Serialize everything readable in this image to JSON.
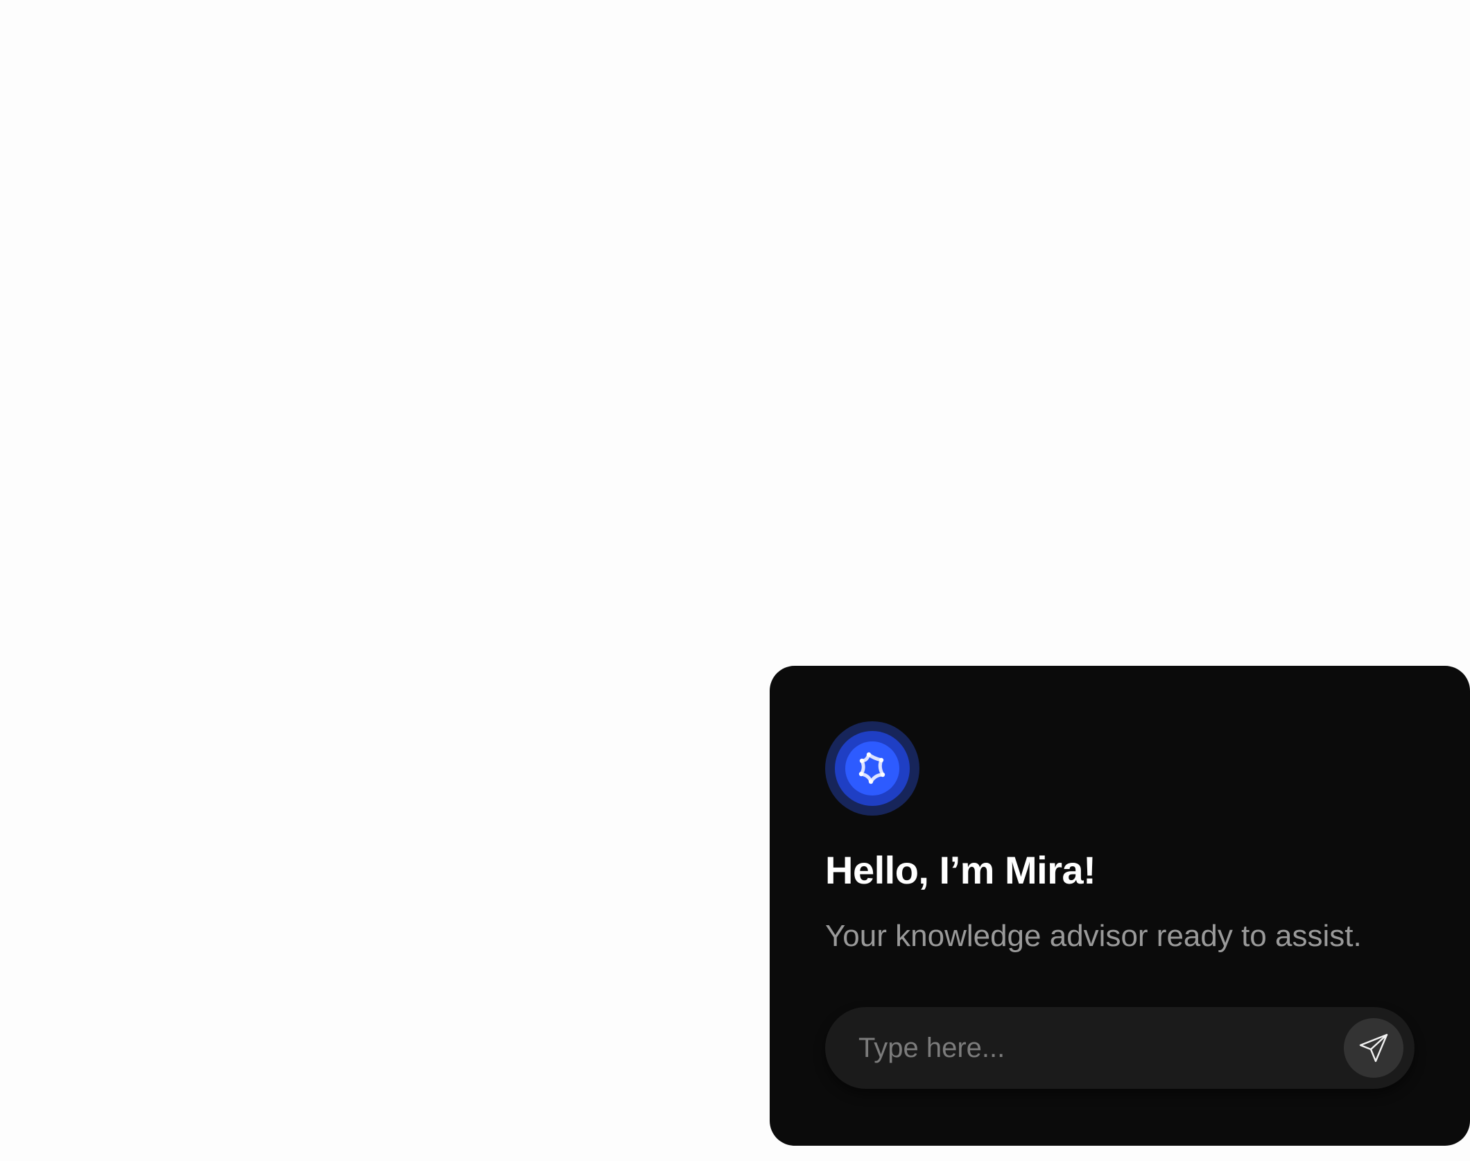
{
  "assistant": {
    "title": "Hello, I’m Mira!",
    "subtitle": "Your knowledge advisor ready to assist.",
    "avatar_icon": "sparkle-star-icon"
  },
  "composer": {
    "placeholder": "Type here...",
    "value": "",
    "send_icon": "paper-plane-icon"
  },
  "colors": {
    "card_background": "#0b0b0b",
    "page_background": "#fdfdfd",
    "avatar_outer": "#17255a",
    "avatar_ring": "#1f3fc4",
    "avatar_core": "#2d5bff",
    "input_background": "#1b1b1b",
    "send_button": "#333333"
  }
}
